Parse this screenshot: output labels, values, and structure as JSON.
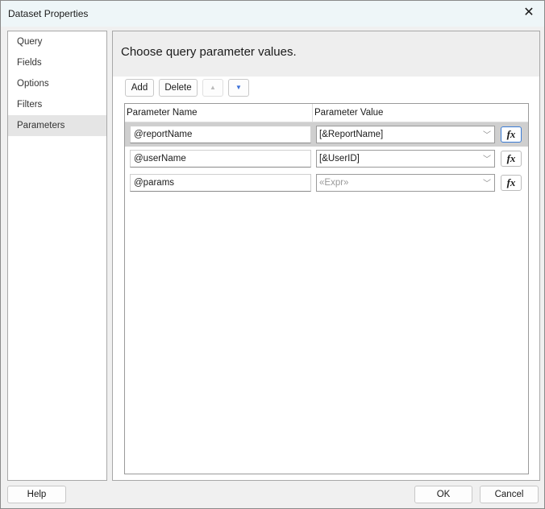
{
  "window": {
    "title": "Dataset Properties"
  },
  "sidebar": {
    "items": [
      {
        "label": "Query"
      },
      {
        "label": "Fields"
      },
      {
        "label": "Options"
      },
      {
        "label": "Filters"
      },
      {
        "label": "Parameters",
        "selected": true
      }
    ]
  },
  "main": {
    "heading": "Choose query parameter values.",
    "toolbar": {
      "add": "Add",
      "delete": "Delete",
      "move_up": "▲",
      "move_down": "▼"
    },
    "grid": {
      "headers": [
        "Parameter Name",
        "Parameter Value"
      ],
      "rows": [
        {
          "name": "@reportName",
          "value": "[&ReportName]",
          "fx": "fx"
        },
        {
          "name": "@userName",
          "value": "[&UserID]",
          "fx": "fx"
        },
        {
          "name": "@params",
          "value": "«Expr»",
          "fx": "fx"
        }
      ]
    }
  },
  "footer": {
    "help": "Help",
    "ok": "OK",
    "cancel": "Cancel"
  }
}
